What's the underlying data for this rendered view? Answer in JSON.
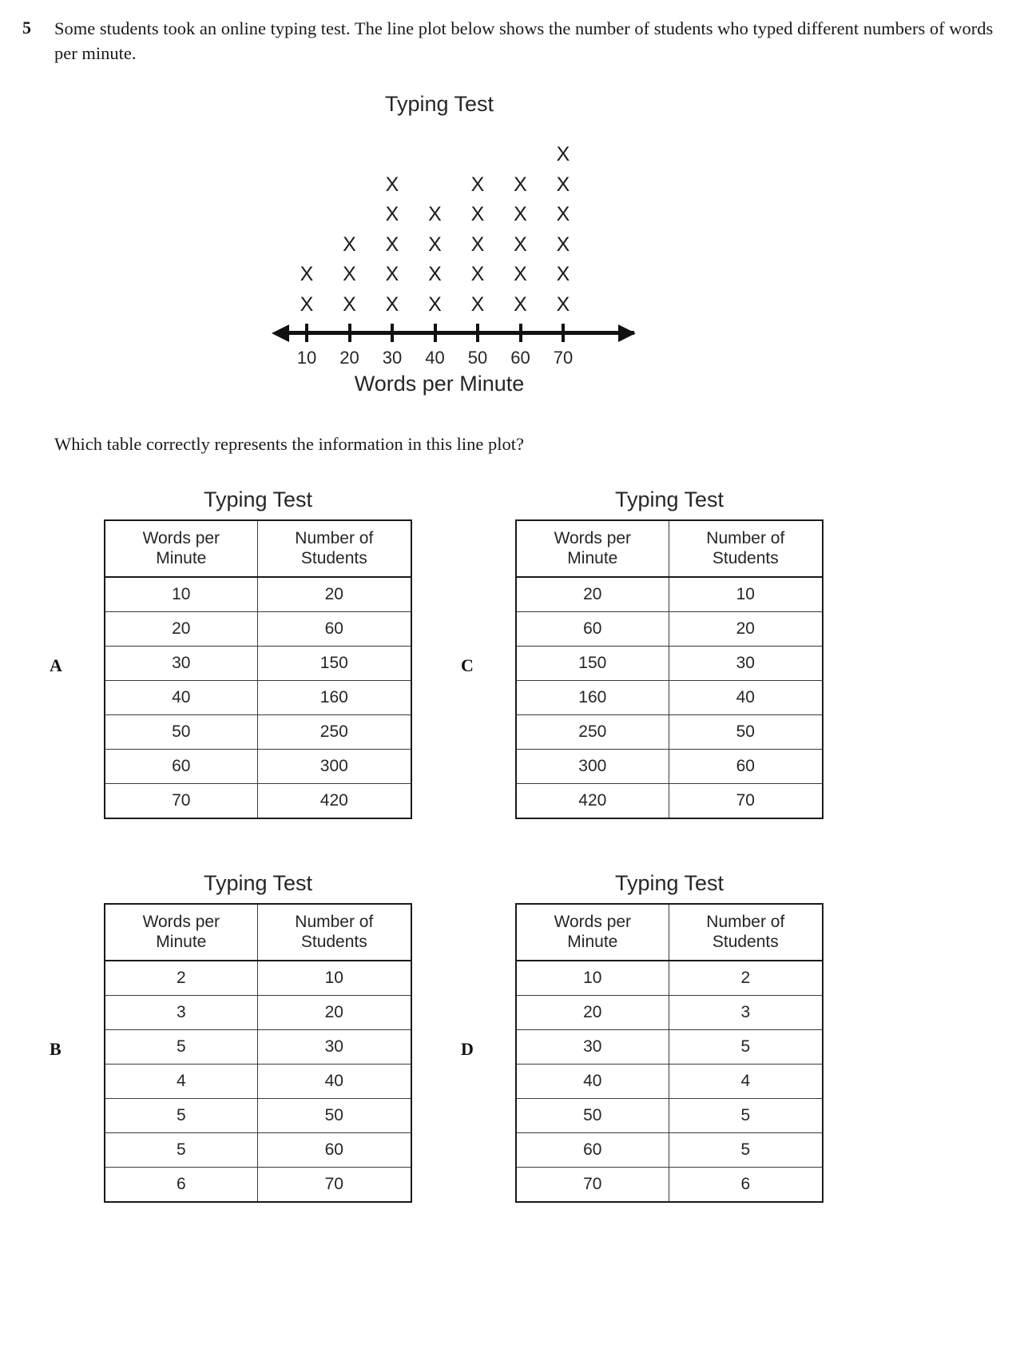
{
  "question": {
    "number": "5",
    "text": "Some students took an online typing test. The line plot below shows the number of students who typed different numbers of words per minute.",
    "prompt": "Which table correctly represents the information in this line plot?"
  },
  "chart_data": {
    "type": "line-plot",
    "title": "Typing Test",
    "xlabel": "Words per Minute",
    "ylabel": "",
    "categories": [
      "10",
      "20",
      "30",
      "40",
      "50",
      "60",
      "70"
    ],
    "values": [
      2,
      3,
      5,
      4,
      5,
      5,
      6
    ],
    "marker": "X",
    "axis_arrows": [
      "left",
      "right"
    ],
    "grid": false,
    "legend": null
  },
  "options": [
    {
      "letter": "A",
      "title": "Typing Test",
      "headers": [
        "Words per Minute",
        "Number of Students"
      ],
      "rows": [
        [
          "10",
          "20"
        ],
        [
          "20",
          "60"
        ],
        [
          "30",
          "150"
        ],
        [
          "40",
          "160"
        ],
        [
          "50",
          "250"
        ],
        [
          "60",
          "300"
        ],
        [
          "70",
          "420"
        ]
      ]
    },
    {
      "letter": "C",
      "title": "Typing Test",
      "headers": [
        "Words per Minute",
        "Number of Students"
      ],
      "rows": [
        [
          "20",
          "10"
        ],
        [
          "60",
          "20"
        ],
        [
          "150",
          "30"
        ],
        [
          "160",
          "40"
        ],
        [
          "250",
          "50"
        ],
        [
          "300",
          "60"
        ],
        [
          "420",
          "70"
        ]
      ]
    },
    {
      "letter": "B",
      "title": "Typing Test",
      "headers": [
        "Words per Minute",
        "Number of Students"
      ],
      "rows": [
        [
          "2",
          "10"
        ],
        [
          "3",
          "20"
        ],
        [
          "5",
          "30"
        ],
        [
          "4",
          "40"
        ],
        [
          "5",
          "50"
        ],
        [
          "5",
          "60"
        ],
        [
          "6",
          "70"
        ]
      ]
    },
    {
      "letter": "D",
      "title": "Typing Test",
      "headers": [
        "Words per Minute",
        "Number of Students"
      ],
      "rows": [
        [
          "10",
          "2"
        ],
        [
          "20",
          "3"
        ],
        [
          "30",
          "5"
        ],
        [
          "40",
          "4"
        ],
        [
          "50",
          "5"
        ],
        [
          "60",
          "5"
        ],
        [
          "70",
          "6"
        ]
      ]
    }
  ]
}
